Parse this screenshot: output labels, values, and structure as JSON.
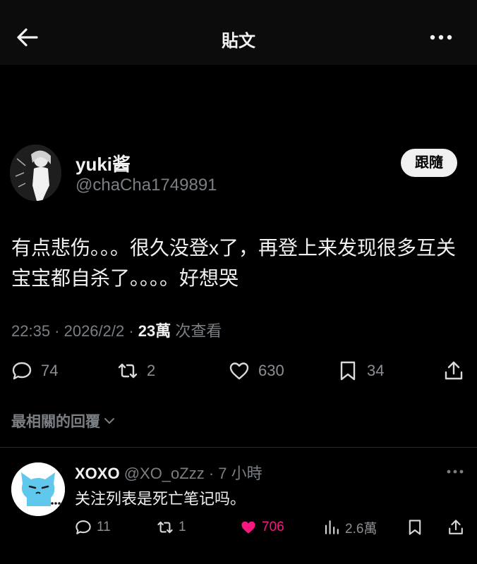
{
  "header": {
    "title": "貼文"
  },
  "post": {
    "author_name": "yuki酱",
    "author_handle": "@chaCha1749891",
    "follow_label": "跟隨",
    "text": "有点悲伤。。。很久没登x了，再登上来发现很多互关宝宝都自杀了。。。。好想哭",
    "time": "22:35 · 2026/2/2 · ",
    "views_count": "23萬",
    "views_label": " 次查看",
    "replies": "74",
    "reposts": "2",
    "likes": "630",
    "bookmarks": "34"
  },
  "sort": {
    "label": "最相關的回覆"
  },
  "reply": {
    "name": "XOXO",
    "handle": " @XO_oZzz",
    "time": " · 7 小時",
    "text": "关注列表是死亡笔记吗。",
    "replies": "11",
    "reposts": "1",
    "likes": "706",
    "views": "2.6萬"
  },
  "colors": {
    "background": "#000000",
    "like_active": "#f91880",
    "muted": "#7a7f84"
  }
}
